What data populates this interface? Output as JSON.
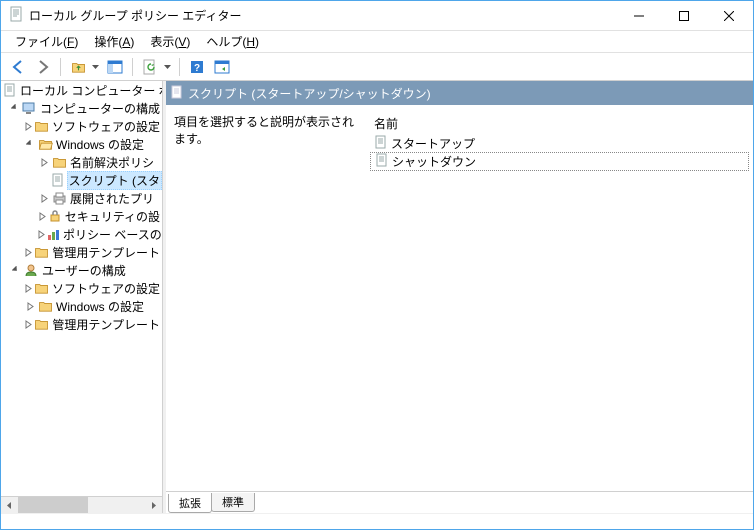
{
  "window": {
    "title": "ローカル グループ ポリシー エディター"
  },
  "menu": {
    "file": "ファイル(",
    "file_u": "F",
    "file_tail": ")",
    "action": "操作(",
    "action_u": "A",
    "action_tail": ")",
    "view": "表示(",
    "view_u": "V",
    "view_tail": ")",
    "help": "ヘルプ(",
    "help_u": "H",
    "help_tail": ")"
  },
  "tree": {
    "root": "ローカル コンピューター ポリシ",
    "computer": "コンピューターの構成",
    "sw1": "ソフトウェアの設定",
    "win1": "Windows の設定",
    "ns": "名前解決ポリシ",
    "scripts": "スクリプト (スタ",
    "deployed": "展開されたプリ",
    "security": "セキュリティの設",
    "policy": "ポリシー ベースの",
    "admin1": "管理用テンプレート",
    "user": "ユーザーの構成",
    "sw2": "ソフトウェアの設定",
    "win2": "Windows の設定",
    "admin2": "管理用テンプレート"
  },
  "detail": {
    "header": "スクリプト (スタートアップ/シャットダウン)",
    "hint": "項目を選択すると説明が表示されます。",
    "col_name": "名前",
    "items": {
      "startup": "スタートアップ",
      "shutdown": "シャットダウン"
    }
  },
  "tabs": {
    "extended": "拡張",
    "standard": "標準"
  }
}
